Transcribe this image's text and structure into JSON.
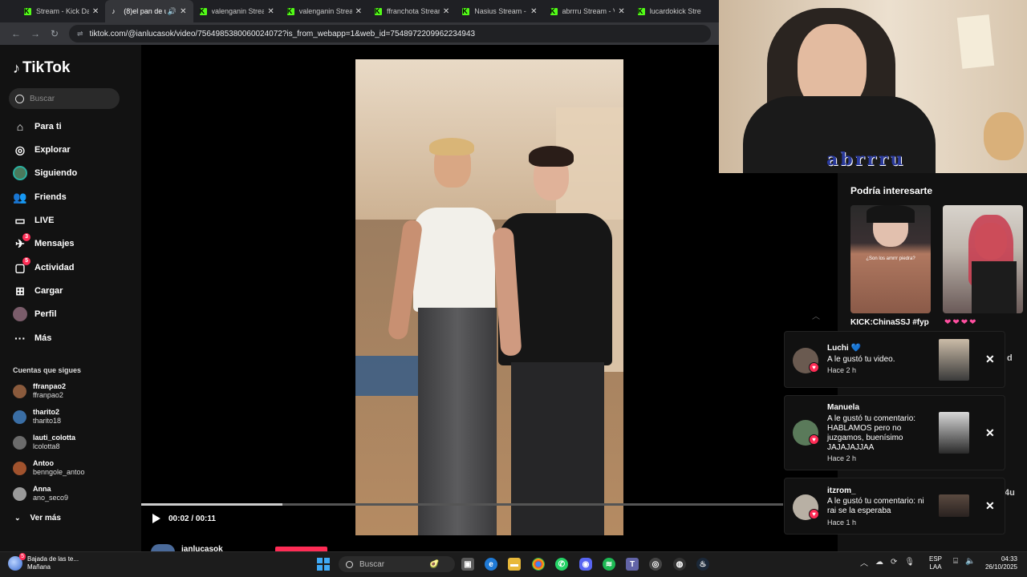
{
  "browser": {
    "tabs": [
      {
        "title": "Stream - Kick Da",
        "favicon": "kick",
        "active": false
      },
      {
        "title": "(8)el pan de u",
        "favicon": "tiktok",
        "active": true,
        "audio": true
      },
      {
        "title": "valenganin Strean",
        "favicon": "kick",
        "active": false
      },
      {
        "title": "valenganin Strean",
        "favicon": "kick",
        "active": false
      },
      {
        "title": "ffranchota Stream",
        "favicon": "kick",
        "active": false
      },
      {
        "title": "Nasius Stream - V",
        "favicon": "kick",
        "active": false
      },
      {
        "title": "abrrru Stream - V",
        "favicon": "kick",
        "active": false
      },
      {
        "title": "lucardokick Stre",
        "favicon": "kick",
        "active": false
      }
    ],
    "url": "tiktok.com/@ianlucasok/video/7564985380060024072?is_from_webapp=1&web_id=7548972209962234943"
  },
  "sidebar": {
    "brand": "TikTok",
    "search_placeholder": "Buscar",
    "nav": [
      {
        "label": "Para ti",
        "icon": "home-icon"
      },
      {
        "label": "Explorar",
        "icon": "compass-icon"
      },
      {
        "label": "Siguiendo",
        "icon": "following-avatar"
      },
      {
        "label": "Friends",
        "icon": "friends-icon"
      },
      {
        "label": "LIVE",
        "icon": "live-icon"
      },
      {
        "label": "Mensajes",
        "icon": "messages-icon",
        "badge": "3"
      },
      {
        "label": "Actividad",
        "icon": "activity-icon",
        "badge": "5"
      },
      {
        "label": "Cargar",
        "icon": "upload-icon"
      },
      {
        "label": "Perfil",
        "icon": "profile-avatar"
      },
      {
        "label": "Más",
        "icon": "more-icon"
      }
    ],
    "following_title": "Cuentas que sigues",
    "following": [
      {
        "name": "ffranpao2",
        "handle": "ffranpao2",
        "color": "#8a5a3c"
      },
      {
        "name": "tharito2",
        "handle": "tharito18",
        "color": "#3a6ea5"
      },
      {
        "name": "lauti_colotta",
        "handle": "lcolotta8",
        "color": "#6b6b6b"
      },
      {
        "name": "Antoo",
        "handle": "benngole_antoo",
        "color": "#a0522d"
      },
      {
        "name": "Anna",
        "handle": "ano_seco9",
        "color": "#9a9a9a"
      }
    ],
    "see_more": "Ver más"
  },
  "player": {
    "time": "00:02 / 00:11",
    "progress": 0.22,
    "author": "ianlucasok"
  },
  "webcam": {
    "overlay_name": "abrrru"
  },
  "suggestions": {
    "title": "Podría interesarte",
    "caption": "KICK:ChinaSSJ #fyp",
    "thumb_overlay": "¿Son los amrrr piedra?"
  },
  "notifications": [
    {
      "user": "Luchi 💙",
      "message": "A le gustó tu video.",
      "time": "Hace 2 h"
    },
    {
      "user": "Manuela",
      "message": "A le gustó tu comentario: HABLAMOS pero no juzgamos, buenísimo JAJAJAJJAA",
      "time": "Hace 2 h"
    },
    {
      "user": "itzrom_",
      "message": "A le gustó tu comentario: ni rai se la esperaba",
      "time": "Hace 1 h"
    }
  ],
  "partial_texts": {
    "right_d": "d",
    "right_4u": "4u"
  },
  "taskbar": {
    "weather_title": "Bajada de las te...",
    "weather_sub": "Mañana",
    "weather_badge": "5",
    "search": "Buscar",
    "lang_1": "ESP",
    "lang_2": "LAA",
    "time": "04:33",
    "date": "26/10/2025"
  },
  "colors": {
    "accent": "#fe2c55",
    "kick": "#53fc18",
    "panel": "#121212"
  }
}
